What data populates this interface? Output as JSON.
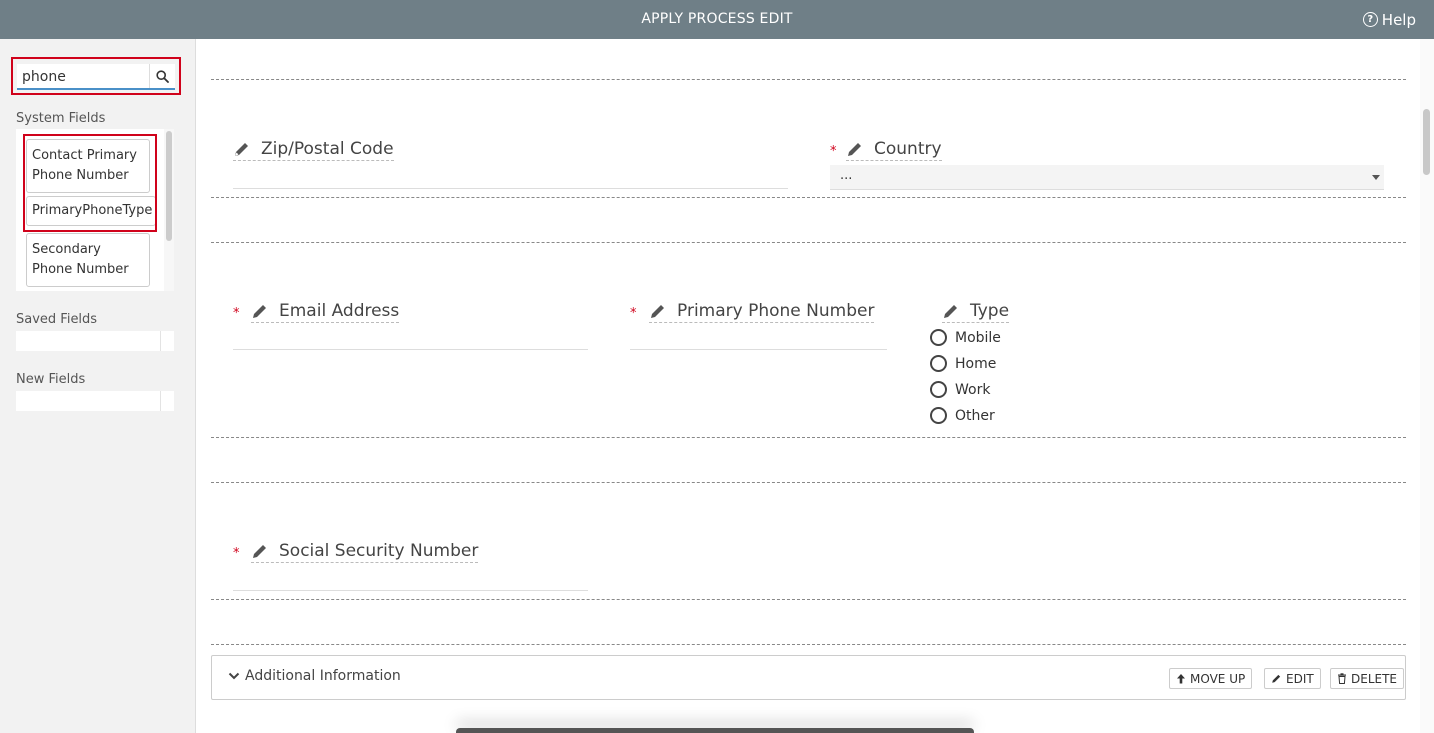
{
  "header": {
    "title": "APPLY PROCESS EDIT",
    "help_label": "Help"
  },
  "sidebar": {
    "search_value": "phone",
    "system_fields_label": "System Fields",
    "system_fields": [
      "Contact Primary Phone Number",
      "PrimaryPhoneType",
      "Secondary Phone Number"
    ],
    "saved_fields_label": "Saved Fields",
    "new_fields_label": "New Fields"
  },
  "form": {
    "zip_label": "Zip/Postal Code",
    "country_label": "Country",
    "country_value": "...",
    "email_label": "Email Address",
    "primary_phone_label": "Primary Phone Number",
    "type_label": "Type",
    "type_options": [
      "Mobile",
      "Home",
      "Work",
      "Other"
    ],
    "ssn_label": "Social Security Number",
    "required_mark": "*"
  },
  "section": {
    "title": "Additional Information",
    "move_up_label": "MOVE UP",
    "edit_label": "EDIT",
    "delete_label": "DELETE"
  },
  "colors": {
    "header_bg": "#6f7f87",
    "highlight": "#d0021b",
    "required": "#d0021b",
    "search_accent": "#4a90c8"
  },
  "icons": [
    "help-icon",
    "search-icon",
    "pencil-icon",
    "chevron-down-icon",
    "arrow-up-icon",
    "trash-icon"
  ]
}
